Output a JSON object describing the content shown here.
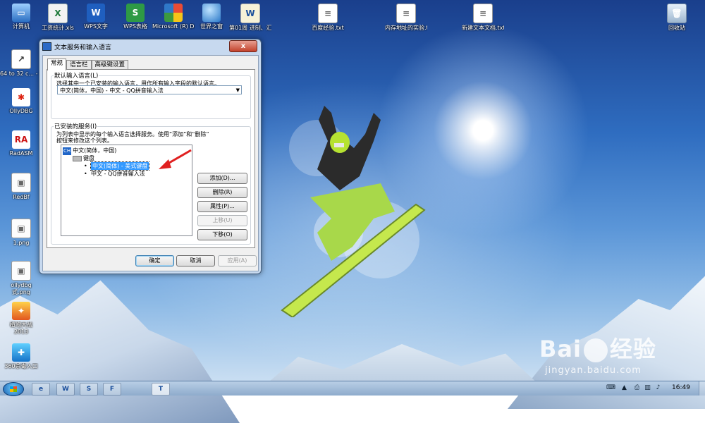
{
  "desktop_icons": {
    "computer": "计算机",
    "xls": "工资统计.xls",
    "wps_word": "WPS文字",
    "wps_et": "WPS表格",
    "ms_dev": "Microsoft (R) Devel...",
    "world": "世界之窗",
    "doc_01": "第01周 进制、汇编...",
    "baidu_txt": "百度经验.txt",
    "mem_txt": "内存地址的实验.txt",
    "new_txt": "新建文本文档.txt",
    "recycle": "回收站",
    "shortcut64": "64 to 32 c... - 快捷方式",
    "ollydbg": "OllyDBG",
    "radasm": "RadASM",
    "redbf": "RedBf",
    "png1": "1.png",
    "convert_png": "ollydbg",
    "convert_png_sub": "式.png",
    "game": "植物大战",
    "game_sub": "2013",
    "antivirus": "360杀毒入口"
  },
  "dialog": {
    "title": "文本服务和输入语言",
    "close": "x",
    "tabs": [
      "常规",
      "语言栏",
      "高级键设置"
    ],
    "default_lang_group": "默认输入语言(L)",
    "default_lang_desc": "选择其中一个已安装的输入语言，用作所有输入字段的默认语言。",
    "default_lang_value": "中文(简体，中国) - 中文 - QQ拼音输入法",
    "installed_group": "已安装的服务(I)",
    "installed_desc_line1": "为列表中显示的每个输入语言选择服务。使用“添加”和“删除”",
    "installed_desc_line2": "按钮来修改这个列表。",
    "tree": {
      "lang_badge": "CH",
      "lang_label": "中文(简体，中国)",
      "keyboard_label": "键盘",
      "item_1": "中文(简体) - 美式键盘",
      "item_2": "中文 - QQ拼音输入法"
    },
    "buttons": {
      "add": "添加(D)...",
      "remove": "删除(R)",
      "properties": "属性(P)...",
      "move_up": "上移(U)",
      "move_down": "下移(O)"
    },
    "footer": {
      "ok": "确定",
      "cancel": "取消",
      "apply": "应用(A)"
    }
  },
  "taskbar": {
    "clock": "16:49",
    "buttons": [
      "e",
      "W",
      "S",
      "F",
      "T"
    ]
  },
  "watermark": {
    "brand": "Bai",
    "brand_tail": "经验",
    "url": "jingyan.baidu.com"
  }
}
